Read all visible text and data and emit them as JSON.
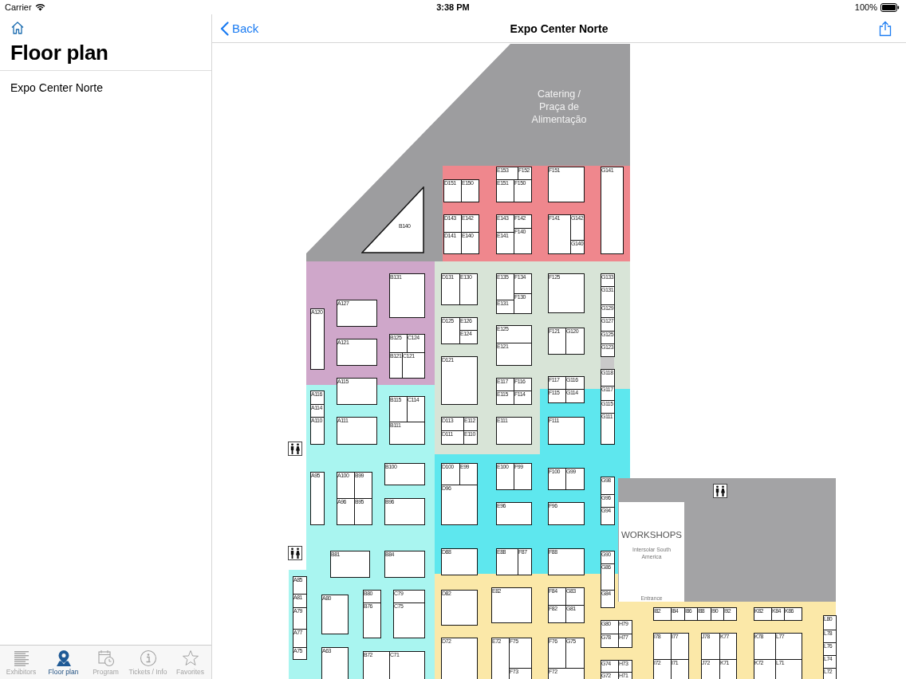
{
  "status_bar": {
    "carrier": "Carrier",
    "time": "3:38 PM",
    "battery": "100%"
  },
  "sidebar": {
    "title": "Floor plan",
    "items": [
      {
        "label": "Expo Center Norte",
        "selected": false
      }
    ]
  },
  "nav_bar": {
    "back": "Back",
    "title": "Expo Center Norte"
  },
  "floor_plan": {
    "sections": [
      {
        "kind": "catering",
        "color": "#9d9d9f",
        "label": "Catering / Praça de Alimentação"
      },
      {
        "kind": "hall",
        "color": "#ef878d"
      },
      {
        "kind": "hall",
        "color": "#cfa7ca"
      },
      {
        "kind": "hall",
        "color": "#d8e4d7"
      },
      {
        "kind": "hall",
        "color": "#a9f5f0"
      },
      {
        "kind": "hall",
        "color": "#5ee7ee"
      },
      {
        "kind": "hall",
        "color": "#fbe8a8"
      },
      {
        "kind": "workshops",
        "color": "#a3a3a5",
        "label": "WORKSHOPS",
        "sublabel": "Intersolar South America",
        "entrance": "Entrance"
      },
      {
        "kind": "hall",
        "color": "#c9c9c9"
      }
    ],
    "booths": [
      {
        "label": "B140"
      },
      {
        "label": "D151"
      },
      {
        "label": "E150"
      },
      {
        "label": "E153"
      },
      {
        "label": "F152"
      },
      {
        "label": "E151"
      },
      {
        "label": "F150"
      },
      {
        "label": "F151"
      },
      {
        "label": "G141"
      },
      {
        "label": "D143"
      },
      {
        "label": "E142"
      },
      {
        "label": "D141"
      },
      {
        "label": "E140"
      },
      {
        "label": "E143"
      },
      {
        "label": "F142"
      },
      {
        "label": "E141"
      },
      {
        "label": "F140"
      },
      {
        "label": "F141"
      },
      {
        "label": "G142"
      },
      {
        "label": "G140"
      },
      {
        "label": "A120"
      },
      {
        "label": "A127"
      },
      {
        "label": "B131"
      },
      {
        "label": "A121"
      },
      {
        "label": "B125"
      },
      {
        "label": "C124"
      },
      {
        "label": "B121"
      },
      {
        "label": "C121"
      },
      {
        "label": "A115"
      },
      {
        "label": "D131"
      },
      {
        "label": "E130"
      },
      {
        "label": "E135"
      },
      {
        "label": "F134"
      },
      {
        "label": "F130"
      },
      {
        "label": "E131"
      },
      {
        "label": "F125"
      },
      {
        "label": "G133"
      },
      {
        "label": "G131"
      },
      {
        "label": "G129"
      },
      {
        "label": "G127"
      },
      {
        "label": "G125"
      },
      {
        "label": "G123"
      },
      {
        "label": "D125"
      },
      {
        "label": "E126"
      },
      {
        "label": "E124"
      },
      {
        "label": "E125"
      },
      {
        "label": "E121"
      },
      {
        "label": "F121"
      },
      {
        "label": "G120"
      },
      {
        "label": "D121"
      },
      {
        "label": "G118"
      },
      {
        "label": "E117"
      },
      {
        "label": "F116"
      },
      {
        "label": "F117"
      },
      {
        "label": "G116"
      },
      {
        "label": "A116"
      },
      {
        "label": "A114"
      },
      {
        "label": "A110"
      },
      {
        "label": "A111"
      },
      {
        "label": "B115"
      },
      {
        "label": "C114"
      },
      {
        "label": "B111"
      },
      {
        "label": "E115"
      },
      {
        "label": "F114"
      },
      {
        "label": "F115"
      },
      {
        "label": "G114"
      },
      {
        "label": "G117"
      },
      {
        "label": "G115"
      },
      {
        "label": "G111"
      },
      {
        "label": "D113"
      },
      {
        "label": "E112"
      },
      {
        "label": "D111"
      },
      {
        "label": "E110"
      },
      {
        "label": "E111"
      },
      {
        "label": "F111"
      },
      {
        "label": "A95"
      },
      {
        "label": "A100"
      },
      {
        "label": "B99"
      },
      {
        "label": "A96"
      },
      {
        "label": "B95"
      },
      {
        "label": "B100"
      },
      {
        "label": "B96"
      },
      {
        "label": "D100"
      },
      {
        "label": "E99"
      },
      {
        "label": "D96"
      },
      {
        "label": "E100"
      },
      {
        "label": "F99"
      },
      {
        "label": "E96"
      },
      {
        "label": "F100"
      },
      {
        "label": "G99"
      },
      {
        "label": "F96"
      },
      {
        "label": "G98"
      },
      {
        "label": "G96"
      },
      {
        "label": "G94"
      },
      {
        "label": "B81"
      },
      {
        "label": "B84"
      },
      {
        "label": "D88"
      },
      {
        "label": "E88"
      },
      {
        "label": "F87"
      },
      {
        "label": "F88"
      },
      {
        "label": "G90"
      },
      {
        "label": "G86"
      },
      {
        "label": "A85"
      },
      {
        "label": "A81"
      },
      {
        "label": "A79"
      },
      {
        "label": "A77"
      },
      {
        "label": "A75"
      },
      {
        "label": "A80"
      },
      {
        "label": "B80"
      },
      {
        "label": "B76"
      },
      {
        "label": "C79"
      },
      {
        "label": "C75"
      },
      {
        "label": "A63"
      },
      {
        "label": "B72"
      },
      {
        "label": "C71"
      },
      {
        "label": "D82"
      },
      {
        "label": "E82"
      },
      {
        "label": "F84"
      },
      {
        "label": "G83"
      },
      {
        "label": "F82"
      },
      {
        "label": "G81"
      },
      {
        "label": "G84"
      },
      {
        "label": "G80"
      },
      {
        "label": "H79"
      },
      {
        "label": "G78"
      },
      {
        "label": "H77"
      },
      {
        "label": "D72"
      },
      {
        "label": "E72"
      },
      {
        "label": "F75"
      },
      {
        "label": "F73"
      },
      {
        "label": "F76"
      },
      {
        "label": "G75"
      },
      {
        "label": "F72"
      },
      {
        "label": "G74"
      },
      {
        "label": "H73"
      },
      {
        "label": "G72"
      },
      {
        "label": "H71"
      },
      {
        "label": "I82"
      },
      {
        "label": "I84"
      },
      {
        "label": "I86"
      },
      {
        "label": "I88"
      },
      {
        "label": "I90"
      },
      {
        "label": "I92"
      },
      {
        "label": "K82"
      },
      {
        "label": "K84"
      },
      {
        "label": "K86"
      },
      {
        "label": "L80"
      },
      {
        "label": "L78"
      },
      {
        "label": "L76"
      },
      {
        "label": "L74"
      },
      {
        "label": "L72"
      },
      {
        "label": "I78"
      },
      {
        "label": "I77"
      },
      {
        "label": "I72"
      },
      {
        "label": "I71"
      },
      {
        "label": "J78"
      },
      {
        "label": "K77"
      },
      {
        "label": "J72"
      },
      {
        "label": "K71"
      },
      {
        "label": "K78"
      },
      {
        "label": "L77"
      },
      {
        "label": "K72"
      },
      {
        "label": "L71"
      }
    ]
  },
  "tab_bar": [
    {
      "label": "Exhibitors",
      "selected": false
    },
    {
      "label": "Floor plan",
      "selected": true
    },
    {
      "label": "Program",
      "selected": false
    },
    {
      "label": "Tickets / Info",
      "selected": false
    },
    {
      "label": "Favorites",
      "selected": false
    }
  ]
}
